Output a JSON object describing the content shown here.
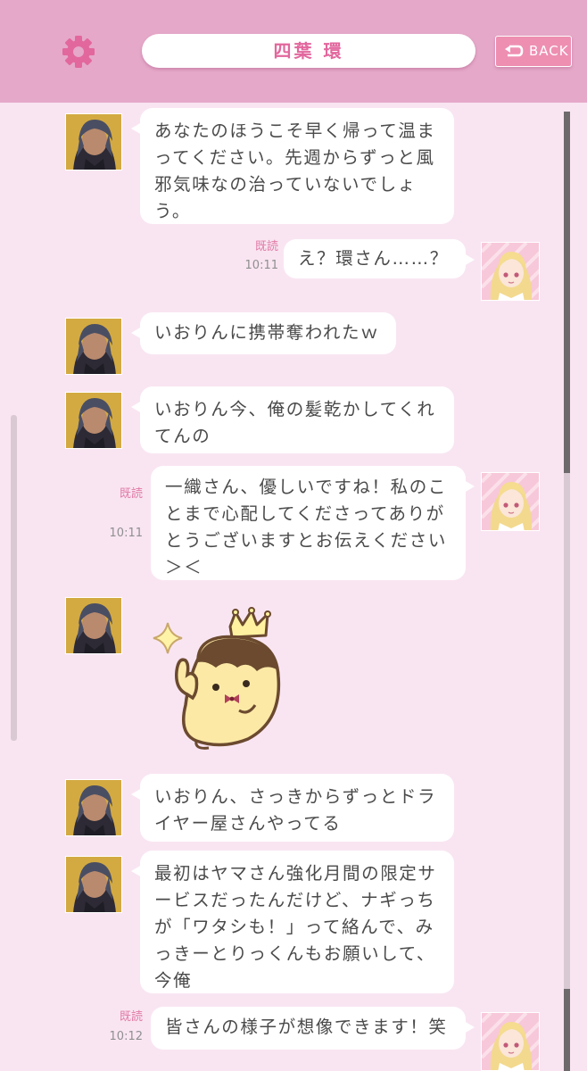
{
  "header": {
    "title": "四葉 環",
    "back_label": "BACK",
    "accent": "#e5a8c8",
    "title_color": "#e2679d"
  },
  "messages": [
    {
      "from": "tamaki",
      "text": "あなたのほうこそ早く帰って温まってください。先週からずっと風邪気味なの治っていないでしょう。"
    },
    {
      "from": "me",
      "read": "既読",
      "time": "10:11",
      "text": "え？環さん……？"
    },
    {
      "from": "tamaki",
      "text": "いおりんに携帯奪われたｗ"
    },
    {
      "from": "tamaki",
      "text": "いおりん今、俺の髪乾かしてくれてんの"
    },
    {
      "from": "me",
      "read": "既読",
      "time": "10:11",
      "text": "一織さん、優しいですね！私のことまで心配してくださってありがとうございますとお伝えください＞＜"
    },
    {
      "from": "tamaki",
      "sticker": "king-pudding-sticker"
    },
    {
      "from": "tamaki",
      "text": "いおりん、さっきからずっとドライヤー屋さんやってる"
    },
    {
      "from": "tamaki",
      "text": "最初はヤマさん強化月間の限定サービスだったんだけど、ナギっちが「ワタシも！」って絡んで、みっきーとりっくんもお願いして、今俺"
    },
    {
      "from": "me",
      "read": "既読",
      "time": "10:12",
      "text": "皆さんの様子が想像できます！笑"
    }
  ],
  "icons": {
    "settings": "gear-icon",
    "back": "return-arrow-icon"
  }
}
